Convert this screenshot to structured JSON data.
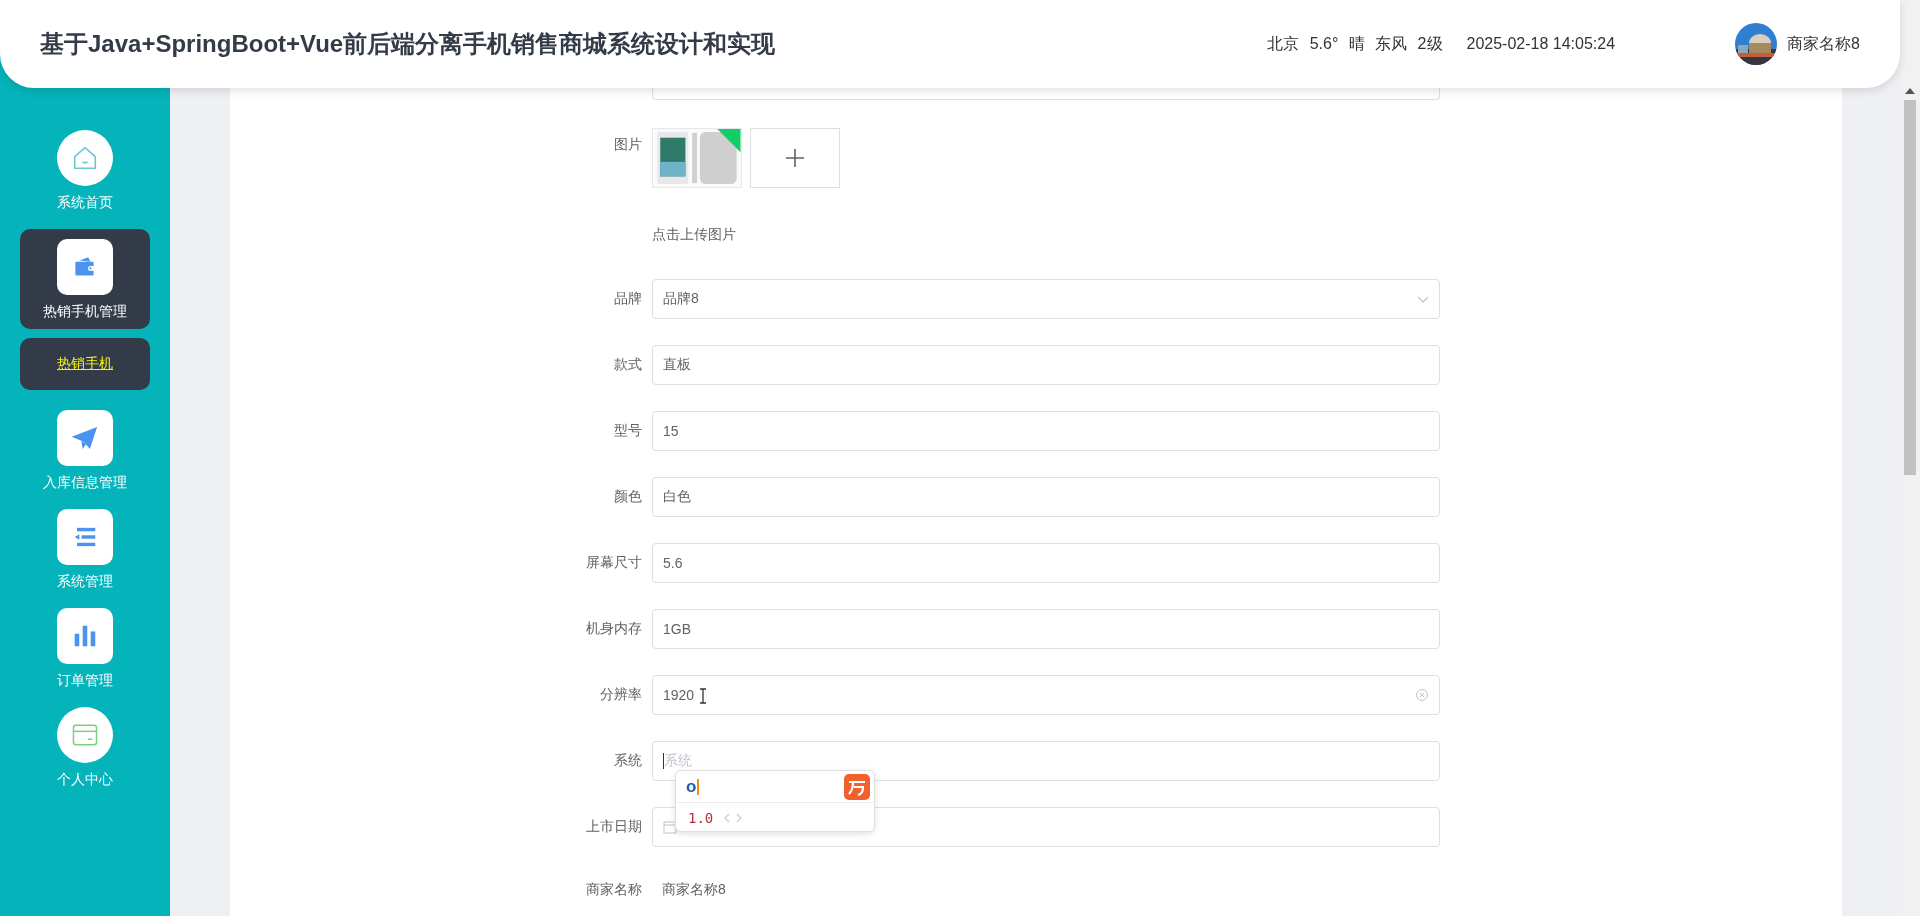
{
  "header": {
    "title": "基于Java+SpringBoot+Vue前后端分离手机销售商城系统设计和实现",
    "weather": "北京 5.6° 晴 东风 2级",
    "datetime": "2025-02-18 14:05:24",
    "user": {
      "name": "商家名称8"
    }
  },
  "sidebar": {
    "items": [
      {
        "label": "系统首页",
        "expanded": false
      },
      {
        "label": "热销手机管理",
        "expanded": true,
        "children": [
          {
            "label": "热销手机",
            "selected": true
          }
        ]
      },
      {
        "label": "入库信息管理",
        "expanded": false
      },
      {
        "label": "系统管理",
        "expanded": false
      },
      {
        "label": "订单管理",
        "expanded": false
      },
      {
        "label": "个人中心",
        "expanded": false
      }
    ]
  },
  "form": {
    "fields": [
      {
        "kind": "images",
        "label": "图片",
        "hint": "点击上传图片"
      },
      {
        "kind": "select",
        "label": "品牌",
        "value": "品牌8"
      },
      {
        "kind": "input",
        "label": "款式",
        "value": "直板"
      },
      {
        "kind": "input",
        "label": "型号",
        "value": "15"
      },
      {
        "kind": "input",
        "label": "颜色",
        "value": "白色"
      },
      {
        "kind": "input",
        "label": "屏幕尺寸",
        "value": "5.6"
      },
      {
        "kind": "input",
        "label": "机身内存",
        "value": "1GB"
      },
      {
        "kind": "input",
        "label": "分辨率",
        "value": "1920",
        "clearable": true
      },
      {
        "kind": "input",
        "label": "系统",
        "placeholder": "系统",
        "focused": true
      },
      {
        "kind": "date",
        "label": "上市日期"
      },
      {
        "kind": "text",
        "label": "商家名称",
        "value": "商家名称8"
      }
    ]
  },
  "ime_popup": {
    "composition": "o",
    "candidate": "1.0"
  }
}
